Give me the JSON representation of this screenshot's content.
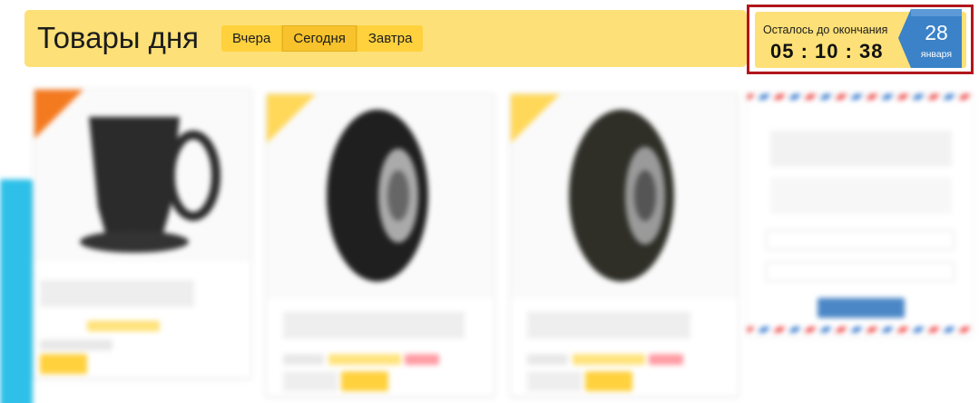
{
  "header": {
    "title": "Товары дня",
    "tabs": [
      {
        "label": "Вчера"
      },
      {
        "label": "Сегодня"
      },
      {
        "label": "Завтра"
      }
    ],
    "active_tab": "Сегодня"
  },
  "countdown": {
    "label": "Осталось до окончания",
    "time": "05 : 10 : 38",
    "day": "28",
    "month": "января"
  },
  "colors": {
    "header_bg": "#fde077",
    "tab_bg": "#ffd13d",
    "highlight_border": "#b1161c",
    "ribbon_blue": "#3b82c8"
  },
  "icons": [
    "date-ribbon-icon"
  ]
}
